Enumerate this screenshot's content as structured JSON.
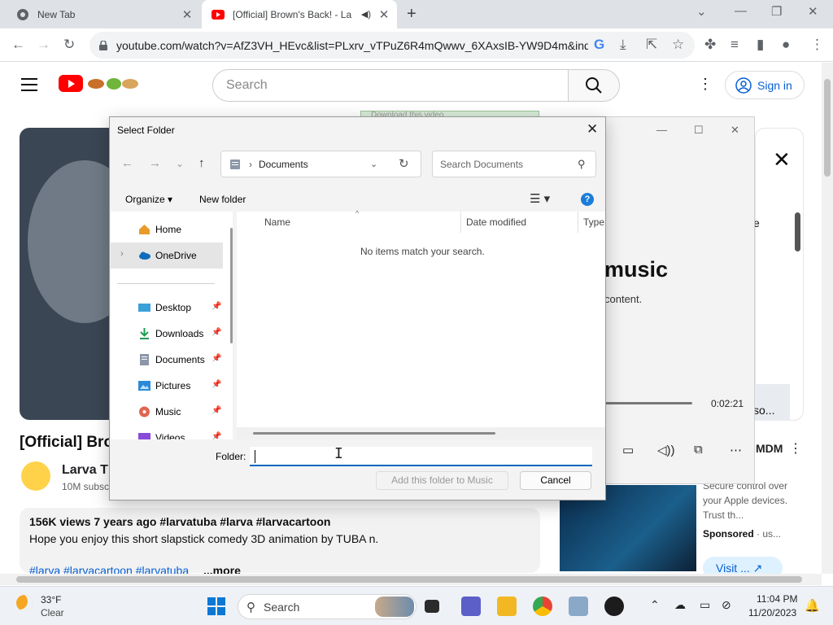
{
  "browser": {
    "tabs": [
      {
        "title": "New Tab",
        "active": false
      },
      {
        "title": "[Official] Brown's Back! - La",
        "active": true
      }
    ],
    "url": "youtube.com/watch?v=AfZ3VH_HEvc&list=PLxrv_vTPuZ6R4mQwwv_6XAxsIB-YW9D4m&ind..."
  },
  "youtube": {
    "search_placeholder": "Search",
    "signin_label": "Sign in",
    "video_title": "[Official] Bro",
    "channel_name": "Larva T",
    "channel_subs": "10M subsc",
    "views_date_tags": "156K views  7 years ago  #larvatuba #larva #larvacartoon",
    "description": "Hope you enjoy this short slapstick comedy 3D animation by TUBA n.",
    "tags_line": "#larva #larvacartoon #larvatuba",
    "more_label": "...more",
    "side_partial_e": "e",
    "side_partial_so": "so...",
    "side_mdm": "MDM",
    "ad_text": "Secure control over your Apple devices. Trust th...",
    "ad_sponsored": "Sponsored",
    "ad_sponsored_suffix": " · us...",
    "ad_visit": "Visit ..."
  },
  "media_player": {
    "heading_partial": "music",
    "subtext_partial": "content.",
    "time": "0:02:21"
  },
  "ghost_banner": "Download this video",
  "dialog": {
    "title": "Select Folder",
    "address_location": "Documents",
    "search_placeholder": "Search Documents",
    "organize_label": "Organize",
    "new_folder_label": "New folder",
    "nav_items": [
      {
        "label": "Home",
        "icon": "home-icon",
        "pinned": false
      },
      {
        "label": "OneDrive",
        "icon": "cloud-icon",
        "pinned": false,
        "selected": true
      },
      {
        "label": "Desktop",
        "icon": "desktop-icon",
        "pinned": true
      },
      {
        "label": "Downloads",
        "icon": "download-icon",
        "pinned": true
      },
      {
        "label": "Documents",
        "icon": "documents-icon",
        "pinned": true
      },
      {
        "label": "Pictures",
        "icon": "pictures-icon",
        "pinned": true
      },
      {
        "label": "Music",
        "icon": "music-icon",
        "pinned": true
      },
      {
        "label": "Videos",
        "icon": "videos-icon",
        "pinned": true
      }
    ],
    "columns": [
      "Name",
      "Date modified",
      "Type"
    ],
    "empty_message": "No items match your search.",
    "folder_label": "Folder:",
    "folder_value": "",
    "add_button": "Add this folder to Music",
    "cancel_button": "Cancel"
  },
  "taskbar": {
    "temperature": "33°F",
    "condition": "Clear",
    "search_label": "Search",
    "time": "11:04 PM",
    "date": "11/20/2023"
  },
  "colors": {
    "accent": "#0067c0",
    "youtube_red": "#ff0000",
    "link_blue": "#065fd4"
  }
}
